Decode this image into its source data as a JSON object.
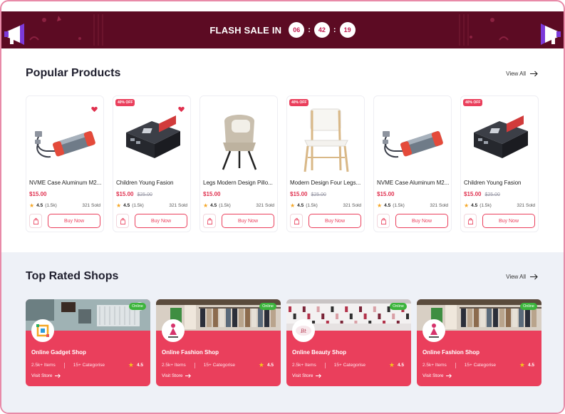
{
  "flash_sale": {
    "title": "FLASH SALE IN",
    "timer": [
      "06",
      "42",
      "19"
    ]
  },
  "popular": {
    "title": "Popular Products",
    "view_all": "View All",
    "products": [
      {
        "name": "NVME Case Aluminum M2...",
        "price": "$15.00",
        "old_price": "",
        "rating": "4.5",
        "reviews": "(1.5k)",
        "sold": "321 Sold",
        "badge": "",
        "wish": true,
        "image": "ssd-case-icon",
        "buy": "Buy Now"
      },
      {
        "name": "Children Young Fasion",
        "price": "$15.00",
        "old_price": "$25.00",
        "rating": "4.5",
        "reviews": "(1.5k)",
        "sold": "321 Sold",
        "badge": "40% OFF",
        "wish": true,
        "image": "mini-pc-icon",
        "buy": "Buy Now"
      },
      {
        "name": "Legs Modern Design Pillo...",
        "price": "$15.00",
        "old_price": "",
        "rating": "4.5",
        "reviews": "(1.5k)",
        "sold": "321 Sold",
        "badge": "",
        "wish": false,
        "image": "lounge-chair-icon",
        "buy": "Buy Now"
      },
      {
        "name": "Modern Design Four Legs...",
        "price": "$15.00",
        "old_price": "$25.00",
        "rating": "4.5",
        "reviews": "(1.5k)",
        "sold": "321 Sold",
        "badge": "40% OFF",
        "wish": false,
        "image": "wooden-chair-icon",
        "buy": "Buy Now"
      },
      {
        "name": "NVME Case Aluminum M2...",
        "price": "$15.00",
        "old_price": "",
        "rating": "4.5",
        "reviews": "(1.5k)",
        "sold": "321 Sold",
        "badge": "",
        "wish": false,
        "image": "ssd-case-icon",
        "buy": "Buy Now"
      },
      {
        "name": "Children Young Fasion",
        "price": "$15.00",
        "old_price": "$25.00",
        "rating": "4.5",
        "reviews": "(1.5k)",
        "sold": "321 Sold",
        "badge": "40% OFF",
        "wish": false,
        "image": "mini-pc-icon",
        "buy": "Buy Now"
      }
    ]
  },
  "shops": {
    "title": "Top Rated Shops",
    "view_all": "View All",
    "items": [
      {
        "name": "Online Gadget Shop",
        "items": "2.5k+ Items",
        "categories": "15+ Categorise",
        "rating": "4.5",
        "status": "Online",
        "visit": "Visit Store",
        "cover": "gadget"
      },
      {
        "name": "Online Fashion Shop",
        "items": "2.5k+ Items",
        "categories": "15+ Categorise",
        "rating": "4.5",
        "status": "Online",
        "visit": "Visit Store",
        "cover": "fashion"
      },
      {
        "name": "Online Beauty Shop",
        "items": "2.5k+ Items",
        "categories": "15+ Categorise",
        "rating": "4.5",
        "status": "Online",
        "visit": "Visit Store",
        "cover": "beauty"
      },
      {
        "name": "Online Fashion Shop",
        "items": "2.5k+ Items",
        "categories": "15+ Categorise",
        "rating": "4.5",
        "status": "Online",
        "visit": "Visit Store",
        "cover": "fashion"
      }
    ]
  },
  "colors": {
    "accent": "#ea3f5c",
    "banner": "#5c0b23",
    "shops_bg": "#eef1f7"
  }
}
